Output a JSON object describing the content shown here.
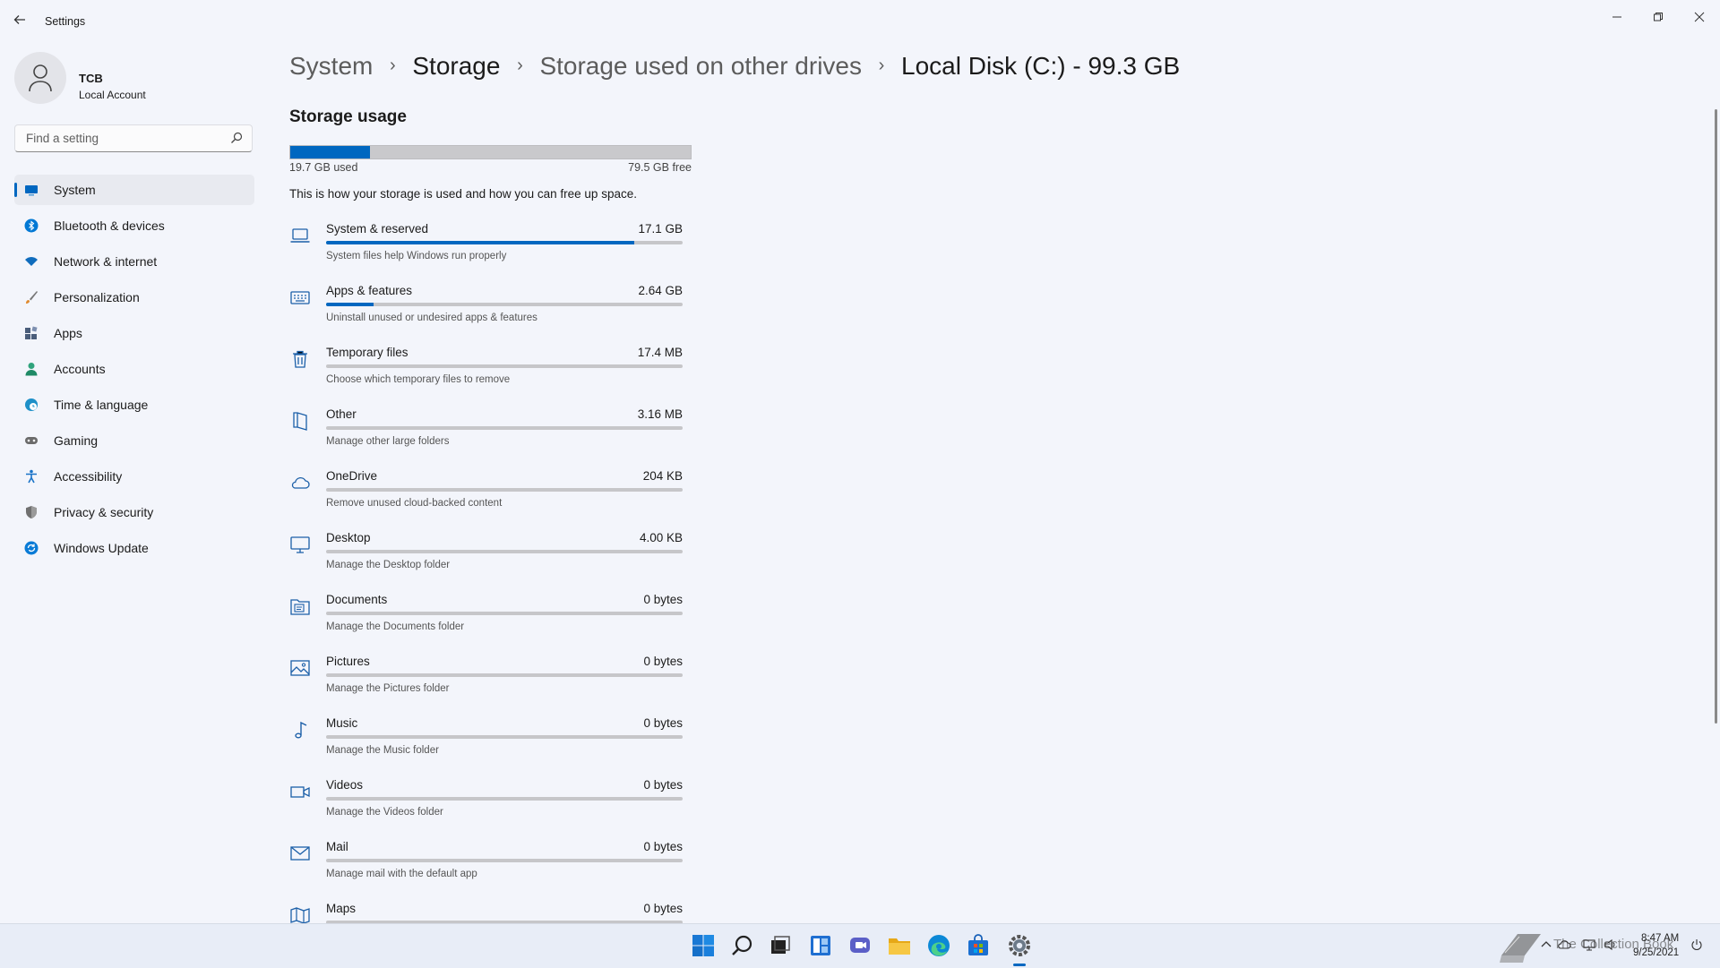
{
  "window": {
    "title": "Settings",
    "back_icon": "back-arrow-icon",
    "controls": [
      "minimize-icon",
      "restore-icon",
      "close-icon"
    ]
  },
  "profile": {
    "name": "TCB",
    "account_type": "Local Account"
  },
  "search": {
    "placeholder": "Find a setting",
    "value": ""
  },
  "nav": {
    "items": [
      {
        "label": "System",
        "icon": "system-icon",
        "color": "#0067c0",
        "active": true
      },
      {
        "label": "Bluetooth & devices",
        "icon": "bluetooth-icon",
        "color": "#0078d4"
      },
      {
        "label": "Network & internet",
        "icon": "wifi-icon",
        "color": "#0f6cbd"
      },
      {
        "label": "Personalization",
        "icon": "brush-icon",
        "color": "#e08a2e"
      },
      {
        "label": "Apps",
        "icon": "apps-icon",
        "color": "#4a5d7a"
      },
      {
        "label": "Accounts",
        "icon": "person-icon",
        "color": "#2fa37c"
      },
      {
        "label": "Time & language",
        "icon": "globe-clock-icon",
        "color": "#1e90c8"
      },
      {
        "label": "Gaming",
        "icon": "gamepad-icon",
        "color": "#6b6b6b"
      },
      {
        "label": "Accessibility",
        "icon": "accessibility-icon",
        "color": "#1a73c7"
      },
      {
        "label": "Privacy & security",
        "icon": "shield-icon",
        "color": "#707070"
      },
      {
        "label": "Windows Update",
        "icon": "update-icon",
        "color": "#0a7bd6"
      }
    ]
  },
  "breadcrumb": {
    "items": [
      "System",
      "Storage",
      "Storage used on other drives",
      "Local Disk (C:) - 99.3 GB"
    ],
    "separator": "›"
  },
  "storage": {
    "section_title": "Storage usage",
    "used_fraction": 0.198,
    "used_label": "19.7 GB used",
    "free_label": "79.5 GB free",
    "description": "This is how your storage is used and how you can free up space.",
    "accent_color": "#0067c0",
    "categories": [
      {
        "name": "System & reserved",
        "size": "17.1 GB",
        "subtitle": "System files help Windows run properly",
        "fraction": 0.865,
        "icon": "laptop-icon"
      },
      {
        "name": "Apps & features",
        "size": "2.64 GB",
        "subtitle": "Uninstall unused or undesired apps & features",
        "fraction": 0.134,
        "icon": "keyboard-icon"
      },
      {
        "name": "Temporary files",
        "size": "17.4 MB",
        "subtitle": "Choose which temporary files to remove",
        "fraction": 0,
        "icon": "trash-icon"
      },
      {
        "name": "Other",
        "size": "3.16 MB",
        "subtitle": "Manage other large folders",
        "fraction": 0,
        "icon": "folder-open-icon"
      },
      {
        "name": "OneDrive",
        "size": "204 KB",
        "subtitle": "Remove unused cloud-backed content",
        "fraction": 0,
        "icon": "cloud-icon"
      },
      {
        "name": "Desktop",
        "size": "4.00 KB",
        "subtitle": "Manage the Desktop folder",
        "fraction": 0,
        "icon": "monitor-icon"
      },
      {
        "name": "Documents",
        "size": "0 bytes",
        "subtitle": "Manage the Documents folder",
        "fraction": 0,
        "icon": "documents-folder-icon"
      },
      {
        "name": "Pictures",
        "size": "0 bytes",
        "subtitle": "Manage the Pictures folder",
        "fraction": 0,
        "icon": "picture-icon"
      },
      {
        "name": "Music",
        "size": "0 bytes",
        "subtitle": "Manage the Music folder",
        "fraction": 0,
        "icon": "music-note-icon"
      },
      {
        "name": "Videos",
        "size": "0 bytes",
        "subtitle": "Manage the Videos folder",
        "fraction": 0,
        "icon": "video-camera-icon"
      },
      {
        "name": "Mail",
        "size": "0 bytes",
        "subtitle": "Manage mail with the default app",
        "fraction": 0,
        "icon": "mail-icon"
      },
      {
        "name": "Maps",
        "size": "0 bytes",
        "subtitle": "",
        "fraction": 0,
        "icon": "map-icon"
      }
    ]
  },
  "taskbar": {
    "apps": [
      "windows-start-icon",
      "search-icon",
      "task-view-icon",
      "widgets-icon",
      "chat-icon",
      "file-explorer-icon",
      "edge-icon",
      "store-icon",
      "settings-icon"
    ],
    "active_app": "settings-icon",
    "tray_icons": [
      "chevron-up-icon",
      "cloud-icon",
      "network-icon",
      "volume-icon",
      "power-icon"
    ],
    "time": "8:47 AM",
    "date": "9/25/2021",
    "watermark_text": "The Collection Book"
  }
}
